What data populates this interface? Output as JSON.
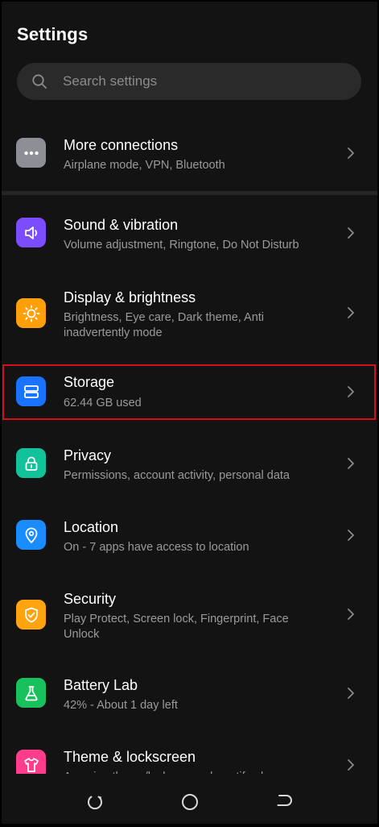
{
  "header": {
    "title": "Settings"
  },
  "search": {
    "placeholder": "Search settings"
  },
  "items": [
    {
      "title": "More connections",
      "subtitle": "Airplane mode, VPN, Bluetooth",
      "icon": "more-dots-icon",
      "color": "#8e8e96"
    },
    {
      "title": "Sound & vibration",
      "subtitle": "Volume adjustment, Ringtone, Do Not Disturb",
      "icon": "speaker-icon",
      "color": "#7b4dff"
    },
    {
      "title": "Display & brightness",
      "subtitle": "Brightness, Eye care, Dark theme, Anti inadvertently mode",
      "icon": "sun-icon",
      "color": "#ff9f0a"
    },
    {
      "title": "Storage",
      "subtitle": "62.44 GB used",
      "icon": "storage-icon",
      "color": "#1a73ff"
    },
    {
      "title": "Privacy",
      "subtitle": "Permissions, account activity, personal data",
      "icon": "lock-icon",
      "color": "#12c29a"
    },
    {
      "title": "Location",
      "subtitle": "On - 7 apps have access to location",
      "icon": "location-pin-icon",
      "color": "#1a8cff"
    },
    {
      "title": "Security",
      "subtitle": "Play Protect, Screen lock, Fingerprint, Face Unlock",
      "icon": "shield-check-icon",
      "color": "#ffa30f"
    },
    {
      "title": "Battery Lab",
      "subtitle": "42% - About 1 day left",
      "icon": "flask-icon",
      "color": "#19c15c"
    },
    {
      "title": "Theme & lockscreen",
      "subtitle": "Amazing theme/lockscreen, beautify phone",
      "icon": "shirt-icon",
      "color": "#ff3d8a"
    }
  ],
  "highlight": {
    "target": "Storage",
    "color": "#d0101a"
  },
  "navbar": {
    "buttons": [
      "recents-icon",
      "home-icon",
      "back-icon"
    ]
  }
}
